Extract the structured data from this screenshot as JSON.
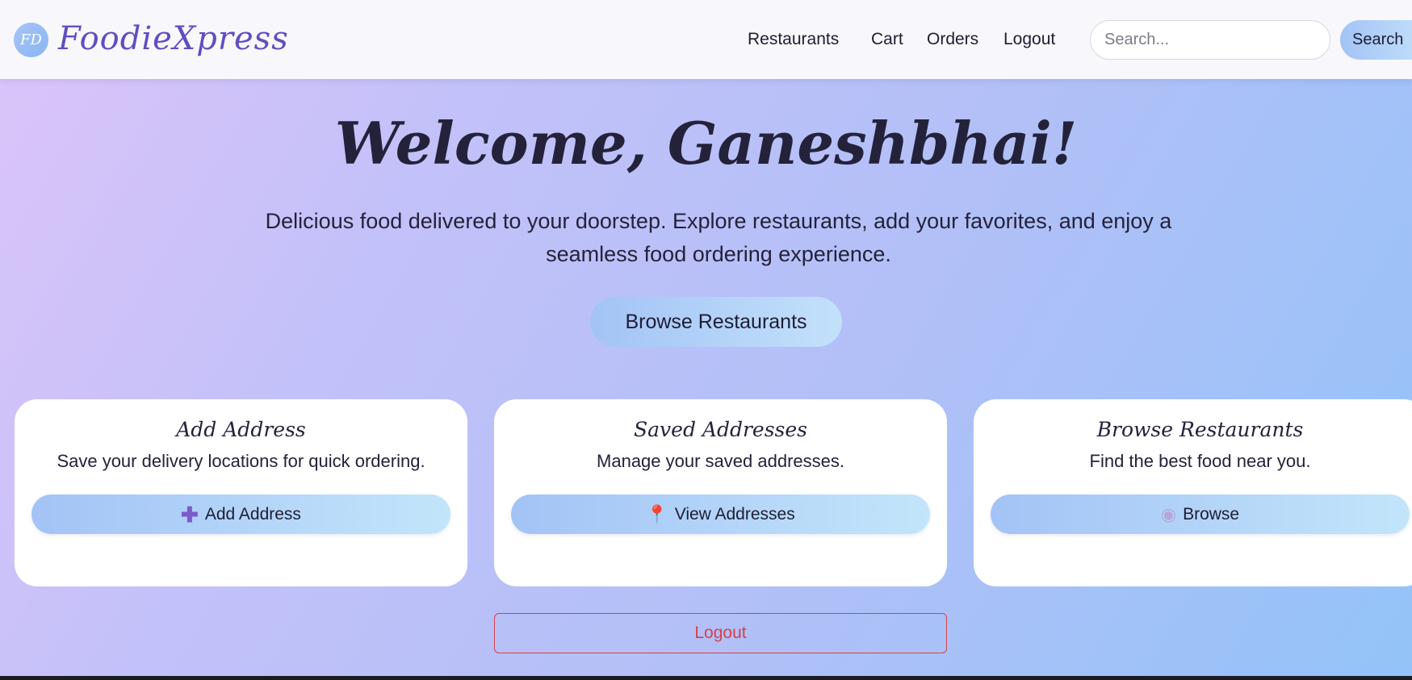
{
  "header": {
    "logo_badge": "FD",
    "brand": "FoodieXpress",
    "nav": [
      "Restaurants",
      "Cart",
      "Orders",
      "Logout"
    ],
    "search": {
      "placeholder": "Search...",
      "button_label": "Search"
    }
  },
  "hero": {
    "title": "Welcome, Ganeshbhai!",
    "tagline": "Delicious food delivered to your doorstep. Explore restaurants, add your favorites, and enjoy a seamless food ordering experience.",
    "cta_label": "Browse Restaurants"
  },
  "cards": [
    {
      "title": "Add Address",
      "description": "Save your delivery locations for quick ordering.",
      "button_label": "Add Address",
      "icon": "plus-icon"
    },
    {
      "title": "Saved Addresses",
      "description": "Manage your saved addresses.",
      "button_label": "View Addresses",
      "icon": "pin-icon"
    },
    {
      "title": "Browse Restaurants",
      "description": "Find the best food near you.",
      "button_label": "Browse",
      "icon": "plate-icon"
    }
  ],
  "logout_label": "Logout",
  "colors": {
    "brand": "#5f4ec1",
    "button_gradient_start": "#a3c3f6",
    "button_gradient_end": "#c3e1fa",
    "logout": "#d9404a"
  }
}
